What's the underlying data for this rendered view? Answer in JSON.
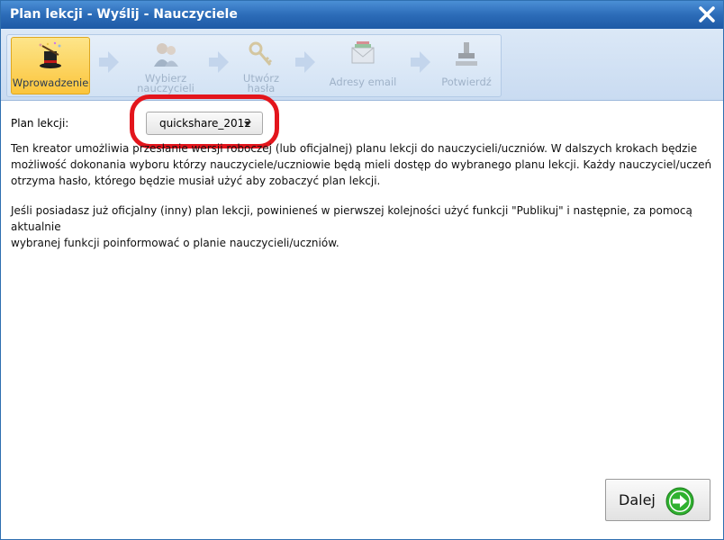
{
  "window": {
    "title": "Plan lekcji - Wyślij - Nauczyciele",
    "close_icon": "close-icon"
  },
  "wizard": {
    "steps": [
      {
        "label_line1": "Wprowadzenie",
        "label_line2": "",
        "icon": "magic-hat-icon",
        "active": true
      },
      {
        "label_line1": "Wybierz",
        "label_line2": "nauczycieli",
        "icon": "teachers-icon",
        "active": false
      },
      {
        "label_line1": "Utwórz",
        "label_line2": "hasła",
        "icon": "keys-icon",
        "active": false
      },
      {
        "label_line1": "Adresy email",
        "label_line2": "",
        "icon": "email-icon",
        "active": false
      },
      {
        "label_line1": "Potwierdź",
        "label_line2": "",
        "icon": "stamp-icon",
        "active": false
      }
    ]
  },
  "form": {
    "plan_label": "Plan lekcji:",
    "plan_selected": "quickshare_2012"
  },
  "text": {
    "para1_line1": "Ten kreator umożliwia przesłanie wersji roboczej (lub oficjalnej) planu lekcji do nauczycieli/uczniów. W dalszych krokach będzie",
    "para1_line2": "możliwość dokonania wyboru którzy nauczyciele/uczniowie będą mieli dostęp do wybranego planu lekcji. Każdy nauczyciel/uczeń",
    "para1_line3": "otrzyma hasło, którego będzie musiał użyć aby zobaczyć plan lekcji.",
    "para2_line1": "Jeśli posiadasz już oficjalny (inny) plan lekcji, powinieneś w pierwszej kolejności użyć funkcji \"Publikuj\" i następnie, za pomocą aktualnie",
    "para2_line2": "wybranej funkcji poinformować o planie nauczycieli/uczniów."
  },
  "buttons": {
    "next_label": "Dalej",
    "next_icon": "green-arrow-right-icon"
  },
  "colors": {
    "titlebar": "#2c6cb8",
    "active_step": "#fbc53c",
    "highlight": "#e3151c",
    "next_icon": "#2fb12f"
  }
}
